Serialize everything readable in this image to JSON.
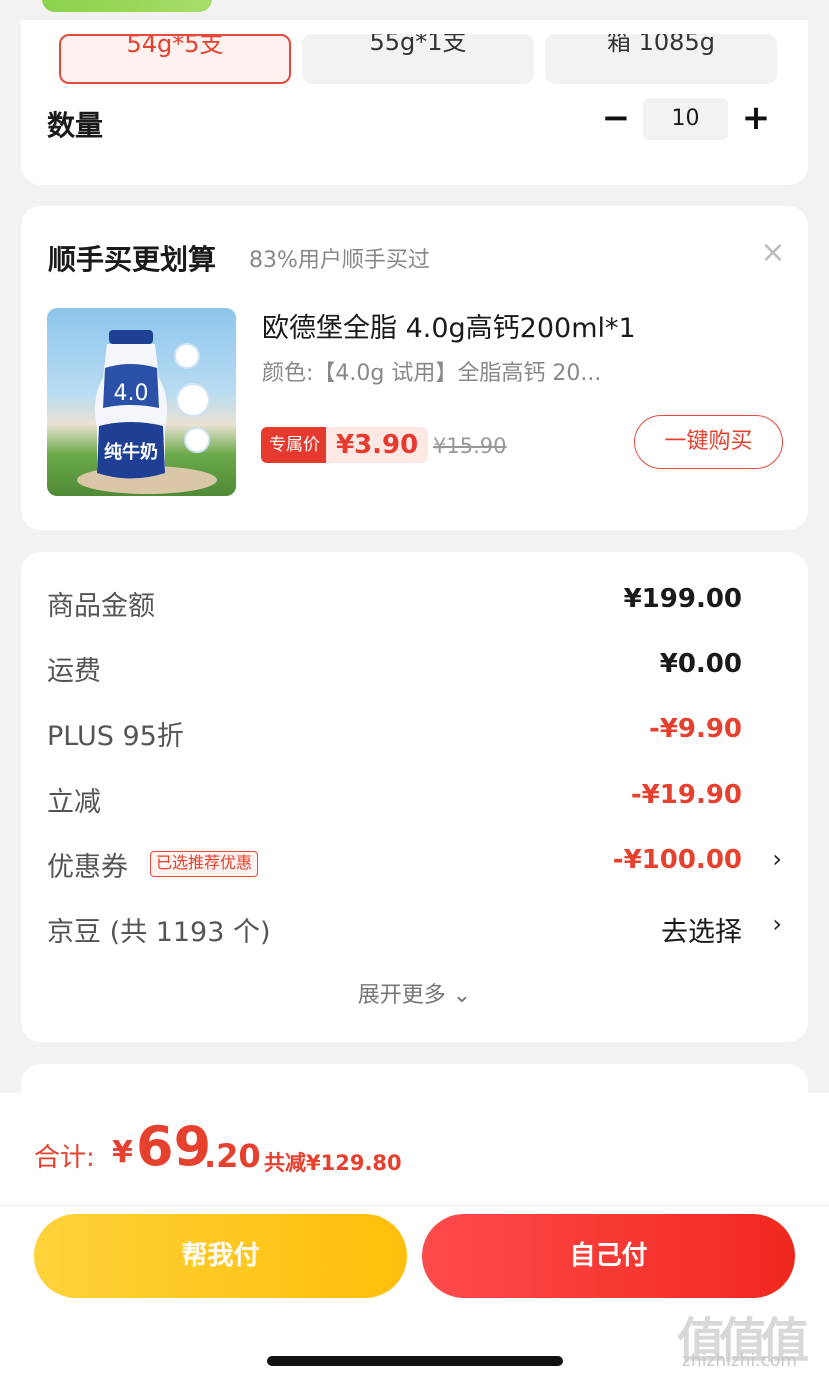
{
  "spec": {
    "options": [
      "54g*5支",
      "55g*1支",
      "箱 1085g"
    ],
    "selected_index": 0
  },
  "quantity": {
    "label": "数量",
    "minus": "−",
    "plus": "+",
    "value": "10"
  },
  "bundle": {
    "title": "顺手买更划算",
    "subtitle": "83%用户顺手买过",
    "close": "×",
    "product": {
      "name": "欧德堡全脂 4.0g高钙200ml*1",
      "attr": "颜色:【4.0g 试用】全脂高钙 20...",
      "exclusive_tag": "专属价",
      "price": "¥3.90",
      "original_price": "¥15.90",
      "buy_label": "一键购买",
      "image_text": "纯牛奶",
      "image_badge": "4.0"
    }
  },
  "price_detail": {
    "rows": [
      {
        "label": "商品金额",
        "value": "¥199.00"
      },
      {
        "label": "运费",
        "value": "¥0.00"
      },
      {
        "label": "PLUS 95折",
        "value": "-¥9.90"
      },
      {
        "label": "立减",
        "value": "-¥19.90"
      },
      {
        "label": "优惠券",
        "badge": "已选推荐优惠",
        "value": "-¥100.00",
        "chevron": "›"
      },
      {
        "label": "京豆 (共 1193 个)",
        "value": "去选择",
        "chevron": "›"
      }
    ],
    "expand": "展开更多 ⌄"
  },
  "footer": {
    "total_label": "合计:",
    "currency": "¥",
    "total_int": "69",
    "total_dec": ".20",
    "saved": "共减¥129.80",
    "help_pay": "帮我付",
    "self_pay": "自己付"
  },
  "watermark": {
    "text": "值值值",
    "site": "zhizhizhi.com"
  },
  "colors": {
    "accent_red": "#e6402e",
    "yellow": "#ffc81a",
    "background": "#f2f2f2"
  }
}
